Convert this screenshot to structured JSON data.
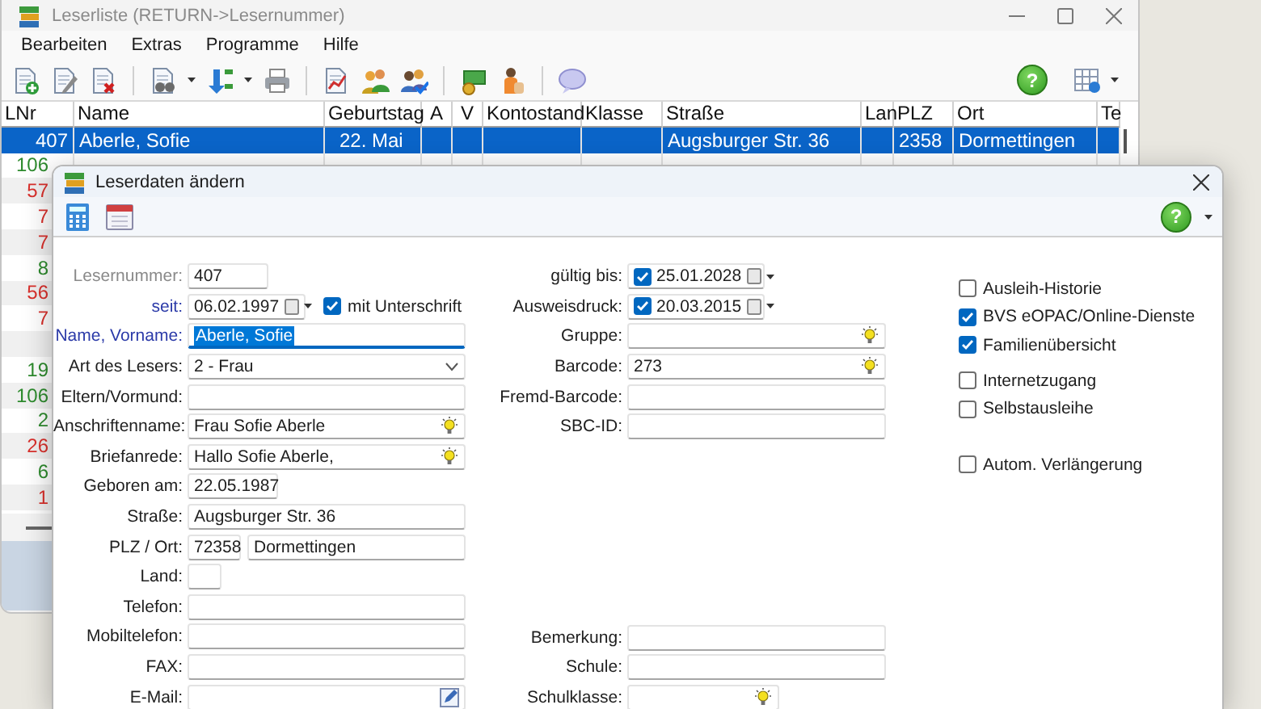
{
  "main_window": {
    "title": "Leserliste (RETURN->Lesernummer)",
    "menu": [
      "Bearbeiten",
      "Extras",
      "Programme",
      "Hilfe"
    ],
    "help_label": "?"
  },
  "list": {
    "columns": [
      "LNr",
      "Name",
      "Geburtstag",
      "A",
      "V",
      "Kontostand",
      "Klasse",
      "Straße",
      "Lan",
      "PLZ",
      "Ort",
      "Te"
    ],
    "rows": [
      {
        "selected": true,
        "cells": [
          "407",
          "Aberle, Sofie",
          "22. Mai",
          null,
          null,
          null,
          null,
          "Augsburger Str. 36",
          null,
          "2358",
          "Dormettingen",
          null
        ]
      },
      {
        "selected": false,
        "color": "#2e8b2e",
        "cells": [
          "106"
        ]
      },
      {
        "selected": false,
        "color": "#d9302c",
        "cells": [
          "57"
        ]
      },
      {
        "selected": false,
        "color": "#d9302c",
        "cells": [
          "7"
        ]
      },
      {
        "selected": false,
        "color": "#d9302c",
        "cells": [
          "7"
        ]
      },
      {
        "selected": false,
        "color": "#2e8b2e",
        "cells": [
          "8"
        ]
      },
      {
        "selected": false,
        "color": "#d9302c",
        "cells": [
          "56"
        ]
      },
      {
        "selected": false,
        "color": "#d9302c",
        "cells": [
          "7"
        ]
      },
      {
        "selected": false,
        "cells": [
          null
        ]
      },
      {
        "selected": false,
        "color": "#2e8b2e",
        "cells": [
          "19"
        ]
      },
      {
        "selected": false,
        "color": "#2e8b2e",
        "cells": [
          "106"
        ]
      },
      {
        "selected": false,
        "color": "#2e8b2e",
        "cells": [
          "2"
        ]
      },
      {
        "selected": false,
        "color": "#d9302c",
        "cells": [
          "26"
        ]
      },
      {
        "selected": false,
        "color": "#2e8b2e",
        "cells": [
          "6"
        ]
      },
      {
        "selected": false,
        "color": "#d9302c",
        "cells": [
          "1"
        ]
      }
    ]
  },
  "dialog": {
    "title": "Leserdaten ändern",
    "help_label": "?",
    "left_fields": [
      {
        "label": "Lesernummer:",
        "kind": "readonly",
        "value": "407",
        "required": false,
        "focused": false
      },
      {
        "label": "seit:",
        "kind": "date_picker",
        "value": "06.02.1997",
        "required": true,
        "focused": false,
        "option": {
          "label": "mit Unterschrift",
          "checked": true
        }
      },
      {
        "label": "Name, Vorname:",
        "kind": "text",
        "value": "Aberle, Sofie",
        "required": true,
        "focused": true
      },
      {
        "label": "Art des Lesers:",
        "kind": "select",
        "value": "2 - Frau",
        "required": false,
        "focused": false
      },
      {
        "label": "Eltern/Vormund:",
        "kind": "text",
        "required": false,
        "focused": false
      },
      {
        "label": "Anschriftenname:",
        "kind": "lookup_text",
        "value": "Frau Sofie Aberle",
        "required": false,
        "focused": false
      },
      {
        "label": "Briefanrede:",
        "kind": "lookup_text",
        "value": "Hallo Sofie Aberle,",
        "required": false,
        "focused": false
      },
      {
        "label": "Geboren am:",
        "kind": "date",
        "value": "22.05.1987",
        "required": false,
        "focused": false
      },
      {
        "label": "Straße:",
        "kind": "text",
        "value": "Augsburger Str. 36",
        "required": false,
        "focused": false
      },
      {
        "label": "PLZ / Ort:",
        "kind": "zip_city",
        "zip": "72358",
        "city": "Dormettingen",
        "required": false,
        "focused": false
      },
      {
        "label": "Land:",
        "kind": "country",
        "required": false,
        "focused": false
      },
      {
        "label": "Telefon:",
        "kind": "text",
        "required": false,
        "focused": false
      },
      {
        "label": "Mobiltelefon:",
        "kind": "text",
        "required": false,
        "focused": false
      },
      {
        "label": "FAX:",
        "kind": "text",
        "required": false,
        "focused": false
      },
      {
        "label": "E-Mail:",
        "kind": "email",
        "required": false,
        "focused": false
      }
    ],
    "card_fields": [
      {
        "label": "gültig bis:",
        "kind": "checked_date",
        "value": "25.01.2028",
        "checked": true
      },
      {
        "label": "Ausweisdruck:",
        "kind": "checked_date",
        "value": "20.03.2015",
        "checked": true
      },
      {
        "label": "Gruppe:",
        "kind": "lookup_text"
      },
      {
        "label": "Barcode:",
        "kind": "lookup_text",
        "value": "273"
      },
      {
        "label": "Fremd-Barcode:",
        "kind": "text"
      },
      {
        "label": "SBC-ID:",
        "kind": "text"
      }
    ],
    "school_fields": [
      {
        "label": "Bemerkung:",
        "kind": "text"
      },
      {
        "label": "Schule:",
        "kind": "text"
      },
      {
        "label": "Schulklasse:",
        "kind": "lookup_short"
      }
    ],
    "option_groups": [
      {
        "options": [
          {
            "label": "Ausleih-Historie",
            "checked": false
          },
          {
            "label": "BVS eOPAC/Online-Dienste",
            "checked": true
          },
          {
            "label": "Familienübersicht",
            "checked": true
          }
        ]
      },
      {
        "options": [
          {
            "label": "Internetzugang",
            "checked": false
          },
          {
            "label": "Selbstausleihe",
            "checked": false
          }
        ]
      },
      {
        "options": [
          {
            "label": "Autom. Verlängerung",
            "checked": false
          }
        ]
      }
    ]
  }
}
